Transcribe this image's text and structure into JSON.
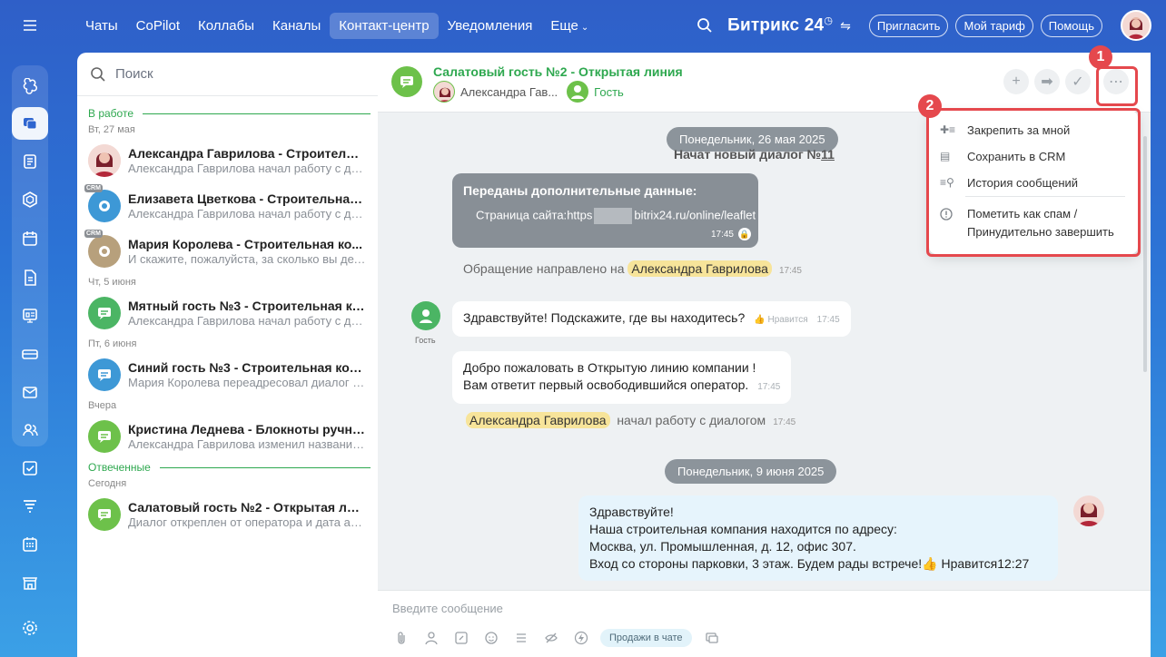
{
  "topbar": {
    "tabs": [
      "Чаты",
      "CoPilot",
      "Коллабы",
      "Каналы",
      "Контакт-центр",
      "Уведомления",
      "Еще"
    ],
    "active_tab": "Контакт-центр",
    "brand": "Битрикс",
    "brand_num": "24",
    "invite": "Пригласить",
    "tariff": "Мой тариф",
    "help": "Помощь"
  },
  "list": {
    "search_placeholder": "Поиск",
    "section_work": "В работе",
    "section_answered": "Отвеченные",
    "dates": [
      "Вт, 27 мая",
      "Чт, 5 июня",
      "Пт, 6 июня",
      "Вчера",
      "Сегодня"
    ],
    "items": [
      {
        "title": "Александра Гаврилова - Строительн...",
        "preview": "Александра Гаврилова начал работу с ди..."
      },
      {
        "title": "Елизавета Цветкова - Строительная ...",
        "preview": "Александра Гаврилова начал работу с ди..."
      },
      {
        "title": "Мария Королева - Строительная ко...",
        "preview": "И скажите, пожалуйста, за сколько вы дел..."
      },
      {
        "title": "Мятный гость №3 - Строительная ко...",
        "preview": "Александра Гаврилова начал работу с ди..."
      },
      {
        "title": "Синий гость №3 - Строительная комп...",
        "preview": "Мария Королева переадресовал диалог н..."
      },
      {
        "title": "Кристина Леднева - Блокноты ручно...",
        "preview": "Александра Гаврилова изменил название..."
      },
      {
        "title": "Салатовый гость №2 - Открытая лин...",
        "preview": "Диалог откреплен от оператора и дата ав..."
      }
    ],
    "crm_badge": "CRM"
  },
  "chat": {
    "title": "Салатовый гость №2 - Открытая линия",
    "operator": "Александра Гав...",
    "guest": "Гость",
    "date1": "Понедельник, 26 мая 2025",
    "new_dialog": "Начат новый диалог №",
    "dialog_num": "11",
    "extra_title": "Переданы дополнительные данные:",
    "extra_page_label": "Страница сайта:",
    "extra_url_start": "https",
    "extra_url_end": "bitrix24.ru/online/leaflet",
    "extra_time": "17:45",
    "routed_text": "Обращение направлено на",
    "operator_name": "Александра Гаврилова",
    "routed_time": "17:45",
    "msg1": "Здравствуйте! Подскажите, где вы находитесь?",
    "like": "Нравится",
    "msg1_time": "17:45",
    "guest_label": "Гость",
    "msg2_line1": "Добро пожаловать в Открытую линию компании !",
    "msg2_line2": "Вам ответит первый освободившийся оператор.",
    "msg2_time": "17:45",
    "started_text": "начал работу с диалогом",
    "started_time": "17:45",
    "date2": "Понедельник, 9 июня 2025",
    "out_line1": "Здравствуйте!",
    "out_line2": "Наша строительная компания находится по адресу:",
    "out_line3": "Москва, ул. Промышленная, д. 12, офис 307.",
    "out_line4": "Вход со стороны парковки, 3 этаж. Будем рады встрече!",
    "out_time": "12:27",
    "composer_placeholder": "Введите сообщение",
    "sales_chip": "Продажи в чате"
  },
  "menu": {
    "pin": "Закрепить за мной",
    "save_crm": "Сохранить в CRM",
    "history": "История сообщений",
    "spam_line1": "Пометить как спам /",
    "spam_line2": "Принудительно завершить"
  },
  "annotations": {
    "badge1": "1",
    "badge2": "2"
  },
  "colors": {
    "accent_green": "#2ea84f",
    "annotation_red": "#e5484d",
    "bar_blue": "#2f5fc8"
  }
}
